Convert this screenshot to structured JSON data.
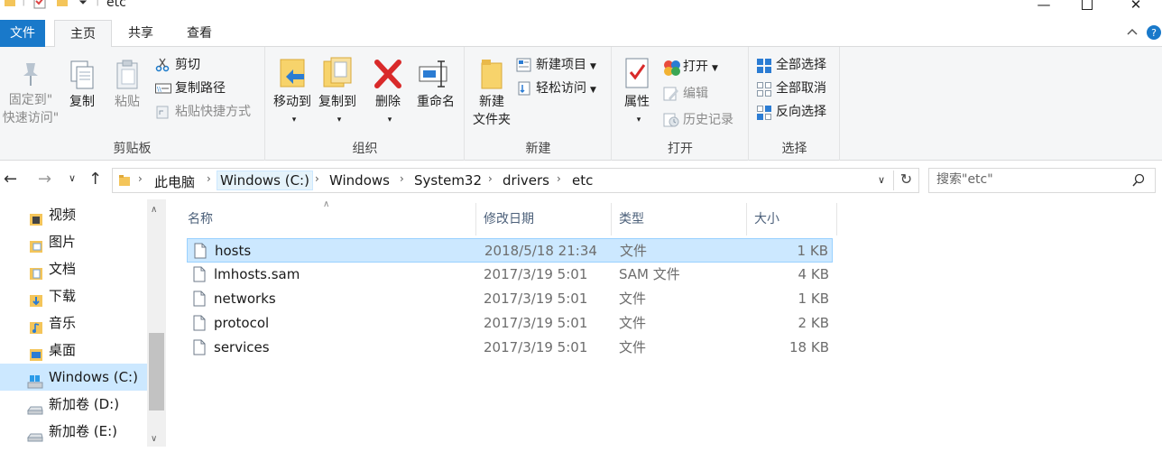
{
  "window": {
    "title": "etc"
  },
  "tabs": {
    "file": "文件",
    "home": "主页",
    "share": "共享",
    "view": "查看"
  },
  "ribbon": {
    "clipboard": {
      "label": "剪贴板",
      "pin_line1": "固定到\"",
      "pin_line2": "快速访问\"",
      "copy": "复制",
      "paste": "粘贴",
      "cut": "剪切",
      "copy_path": "复制路径",
      "paste_shortcut": "粘贴快捷方式"
    },
    "organize": {
      "label": "组织",
      "move_to": "移动到",
      "copy_to": "复制到",
      "delete": "删除",
      "rename": "重命名"
    },
    "new": {
      "label": "新建",
      "new_folder_line1": "新建",
      "new_folder_line2": "文件夹",
      "new_item": "新建项目",
      "easy_access": "轻松访问"
    },
    "open": {
      "label": "打开",
      "properties": "属性",
      "open": "打开",
      "edit": "编辑",
      "history": "历史记录"
    },
    "select": {
      "label": "选择",
      "select_all": "全部选择",
      "select_none": "全部取消",
      "invert": "反向选择"
    }
  },
  "address": {
    "crumbs": [
      "此电脑",
      "Windows (C:)",
      "Windows",
      "System32",
      "drivers",
      "etc"
    ],
    "search_placeholder": "搜索\"etc\""
  },
  "nav_pane": {
    "items": [
      {
        "label": "视频",
        "icon": "video-folder-icon"
      },
      {
        "label": "图片",
        "icon": "pictures-folder-icon"
      },
      {
        "label": "文档",
        "icon": "documents-folder-icon"
      },
      {
        "label": "下载",
        "icon": "downloads-folder-icon"
      },
      {
        "label": "音乐",
        "icon": "music-folder-icon"
      },
      {
        "label": "桌面",
        "icon": "desktop-folder-icon"
      },
      {
        "label": "Windows (C:)",
        "icon": "windows-drive-icon",
        "selected": true
      },
      {
        "label": "新加卷 (D:)",
        "icon": "drive-icon"
      },
      {
        "label": "新加卷 (E:)",
        "icon": "drive-icon"
      }
    ]
  },
  "file_list": {
    "columns": {
      "name": "名称",
      "modified": "修改日期",
      "type": "类型",
      "size": "大小"
    },
    "rows": [
      {
        "name": "hosts",
        "modified": "2018/5/18 21:34",
        "type": "文件",
        "size": "1 KB",
        "selected": true
      },
      {
        "name": "lmhosts.sam",
        "modified": "2017/3/19 5:01",
        "type": "SAM 文件",
        "size": "4 KB"
      },
      {
        "name": "networks",
        "modified": "2017/3/19 5:01",
        "type": "文件",
        "size": "1 KB"
      },
      {
        "name": "protocol",
        "modified": "2017/3/19 5:01",
        "type": "文件",
        "size": "2 KB"
      },
      {
        "name": "services",
        "modified": "2017/3/19 5:01",
        "type": "文件",
        "size": "18 KB"
      }
    ]
  },
  "colors": {
    "accent": "#1979ca",
    "selection": "#cce8ff",
    "selection_border": "#99d1ff",
    "ribbon_bg": "#f5f6f7"
  }
}
